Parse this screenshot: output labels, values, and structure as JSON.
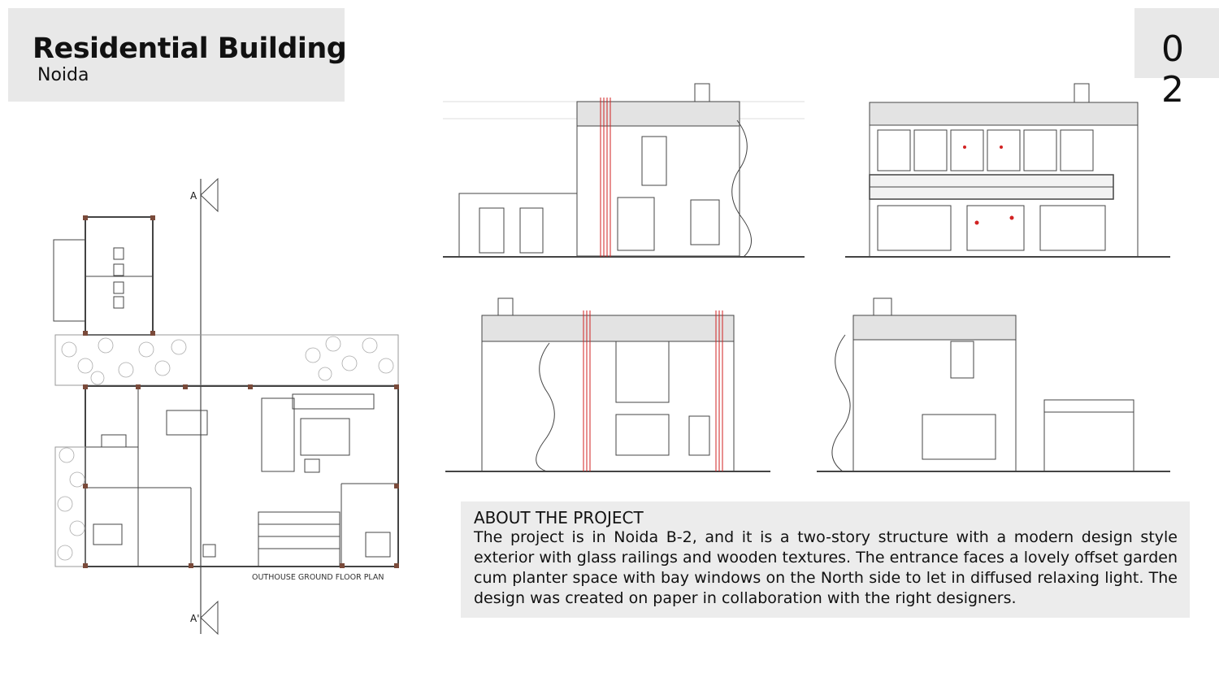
{
  "header": {
    "title": "Residential Building",
    "location": "Noida"
  },
  "page_number": "02",
  "plan": {
    "caption": "OUTHOUSE GROUND FLOOR PLAN",
    "section_mark_top": "A",
    "section_mark_bottom": "A'"
  },
  "about": {
    "heading": "ABOUT THE PROJECT",
    "text": "The project is in Noida B-2, and it is a two-story structure with a modern design style exterior with glass railings and wooden textures. The entrance faces a lovely offset garden cum planter space with bay windows on the North side to let in diffused relaxing light. The design was created on paper in collaboration with the right designers."
  },
  "colors": {
    "panel_bg": "#e8e8e8",
    "drawing_line": "#444444",
    "accent_red": "#d22222"
  }
}
